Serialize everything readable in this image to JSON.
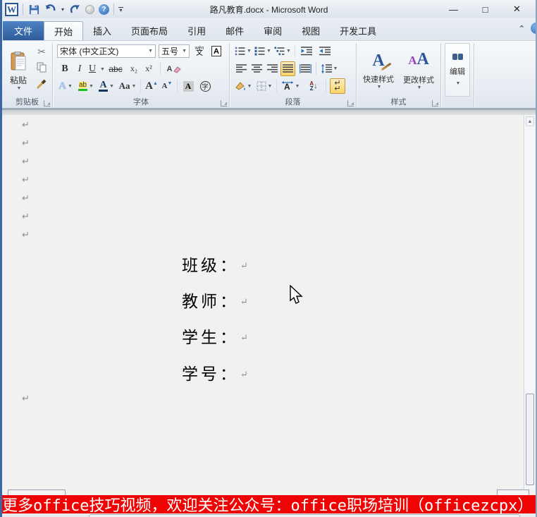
{
  "window": {
    "title": "路凡教育.docx - Microsoft Word",
    "minimize": "—",
    "maximize": "□",
    "close": "✕",
    "collapse_ribbon": "⌃"
  },
  "qat": {
    "word_logo": "W",
    "help": "?",
    "undo_caret": "▾",
    "customize_caret": "▾"
  },
  "tabs": [
    {
      "label": "文件"
    },
    {
      "label": "开始"
    },
    {
      "label": "插入"
    },
    {
      "label": "页面布局"
    },
    {
      "label": "引用"
    },
    {
      "label": "邮件"
    },
    {
      "label": "审阅"
    },
    {
      "label": "视图"
    },
    {
      "label": "开发工具"
    }
  ],
  "ribbon": {
    "clipboard": {
      "group_label": "剪贴板",
      "paste_label": "粘贴",
      "paste_caret": "▾"
    },
    "font": {
      "group_label": "字体",
      "font_name": "宋体 (中文正文)",
      "font_size": "五号",
      "phonetic_py": "wén",
      "phonetic_han": "文",
      "char_border": "A",
      "bold": "B",
      "italic": "I",
      "underline": "U",
      "strikethrough": "abc",
      "subscript": "x₂",
      "superscript": "x²",
      "clear_format": "A",
      "text_effects": "A",
      "highlight": "ab",
      "font_color": "A",
      "change_case": "Aa",
      "grow_font": "A",
      "shrink_font": "A",
      "char_shading": "A",
      "enclose_char": "字"
    },
    "paragraph": {
      "group_label": "段落",
      "sort_a": "A",
      "sort_z": "Z"
    },
    "styles": {
      "group_label": "样式",
      "quick_styles_label": "快速样式",
      "change_styles_label": "更改样式",
      "quick_icon": "A",
      "change_icon_small": "A",
      "change_icon_big": "A"
    },
    "editing": {
      "label": "编辑"
    }
  },
  "document": {
    "pilcrow": "↵",
    "lines": [
      {
        "text": "班级："
      },
      {
        "text": "教师："
      },
      {
        "text": "学生："
      },
      {
        "text": "学号："
      }
    ]
  },
  "banner": {
    "text": "更多office技巧视频，欢迎关注公众号：office职场培训（officezcpx）"
  },
  "colors": {
    "file_tab_blue": "#2e5c9a",
    "toggle_highlight": "#fbd46b",
    "banner_red": "#ee0404",
    "highlight_green": "#19c119"
  }
}
